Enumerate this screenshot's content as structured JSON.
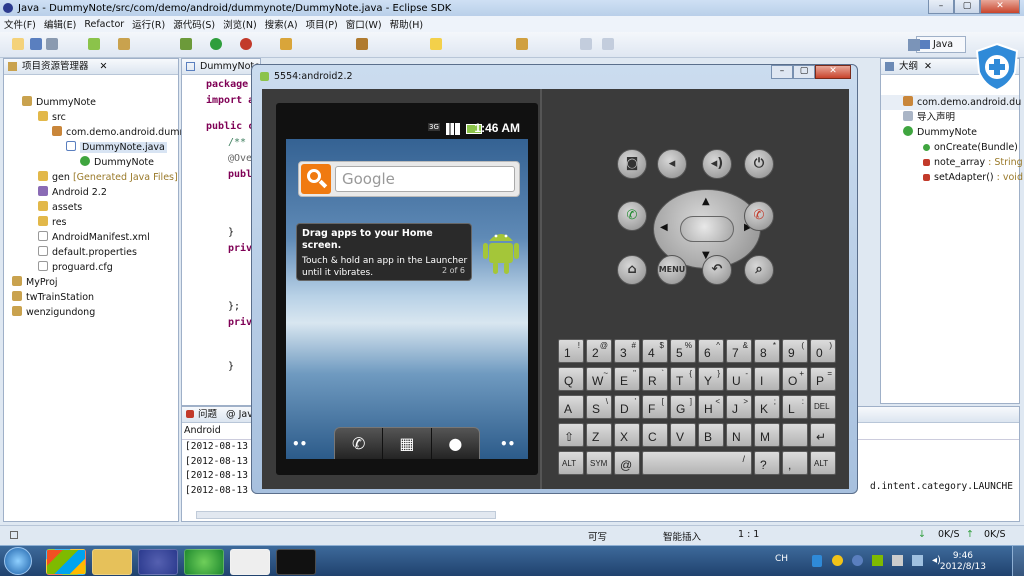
{
  "eclipse": {
    "title": "Java - DummyNote/src/com/demo/android/dummynote/DummyNote.java - Eclipse SDK",
    "menu": [
      "文件(F)",
      "编辑(E)",
      "Refactor",
      "运行(R)",
      "源代码(S)",
      "浏览(N)",
      "搜索(A)",
      "项目(P)",
      "窗口(W)",
      "帮助(H)"
    ],
    "perspective": "Java"
  },
  "explorer": {
    "tab": "项目资源管理器",
    "items": [
      {
        "label": "DummyNote"
      },
      {
        "label": "src"
      },
      {
        "label": "com.demo.android.dumm"
      },
      {
        "label": "DummyNote.java"
      },
      {
        "label": "DummyNote"
      },
      {
        "label": "gen",
        "extra": "[Generated Java Files]"
      },
      {
        "label": "Android 2.2"
      },
      {
        "label": "assets"
      },
      {
        "label": "res"
      },
      {
        "label": "AndroidManifest.xml"
      },
      {
        "label": "default.properties"
      },
      {
        "label": "proguard.cfg"
      },
      {
        "label": "MyProj"
      },
      {
        "label": "twTrainStation"
      },
      {
        "label": "wenzigundong"
      }
    ]
  },
  "editor": {
    "tab": "DummyNote",
    "lines": [
      "package",
      "import a",
      "public c",
      "/**",
      "@Ove",
      "publ",
      "}",
      "priv",
      "};",
      "priv",
      "}"
    ]
  },
  "outline": {
    "tab": "大纲",
    "items": [
      {
        "label": "com.demo.android.du"
      },
      {
        "label": "导入声明"
      },
      {
        "label": "DummyNote"
      },
      {
        "label": "onCreate(Bundle)"
      },
      {
        "label": "note_array",
        "type": ": String"
      },
      {
        "label": "setAdapter()",
        "type": ": void"
      }
    ]
  },
  "console": {
    "tabs": [
      "问题",
      "Jav"
    ],
    "heading": "Android",
    "lines": [
      "[2012-08-13",
      "[2012-08-13",
      "[2012-08-13",
      "[2012-08-13"
    ],
    "tail": "d.intent.category.LAUNCHE"
  },
  "emulator": {
    "title": "5554:android2.2",
    "status_signal": "3G",
    "clock": "1:46 AM",
    "search_placeholder": "Google",
    "tip_title": "Drag apps to your Home screen.",
    "tip_body": "Touch & hold an app in the Launcher until it vibrates.",
    "tip_page": "2 of 6",
    "menu_key": "MENU",
    "keyboard": {
      "row1": [
        [
          "1",
          "!"
        ],
        [
          "2",
          "@"
        ],
        [
          "3",
          "#"
        ],
        [
          "4",
          "$"
        ],
        [
          "5",
          "%"
        ],
        [
          "6",
          "^"
        ],
        [
          "7",
          "&"
        ],
        [
          "8",
          "*"
        ],
        [
          "9",
          "("
        ],
        [
          "0",
          ")"
        ]
      ],
      "row2": [
        [
          "Q",
          ""
        ],
        [
          "W",
          "~"
        ],
        [
          "E",
          "\""
        ],
        [
          "R",
          "`"
        ],
        [
          "T",
          "{"
        ],
        [
          "Y",
          "}"
        ],
        [
          "U",
          "-"
        ],
        [
          "I",
          ""
        ],
        [
          "O",
          "+"
        ],
        [
          "P",
          "="
        ]
      ],
      "row3": [
        [
          "A",
          ""
        ],
        [
          "S",
          "\\"
        ],
        [
          "D",
          "'"
        ],
        [
          "F",
          "["
        ],
        [
          "G",
          "]"
        ],
        [
          "H",
          "<"
        ],
        [
          "J",
          ">"
        ],
        [
          "K",
          ";"
        ],
        [
          "L",
          ":"
        ],
        [
          "DEL",
          ""
        ]
      ],
      "row4": [
        [
          "⇧",
          ""
        ],
        [
          "Z",
          ""
        ],
        [
          "X",
          ""
        ],
        [
          "C",
          ""
        ],
        [
          "V",
          ""
        ],
        [
          "B",
          ""
        ],
        [
          "N",
          ""
        ],
        [
          "M",
          ""
        ],
        [
          "",
          ""
        ],
        [
          "↵",
          ""
        ]
      ],
      "row5": [
        "ALT",
        "SYM",
        "@",
        "/",
        "?",
        ",",
        "ALT"
      ]
    }
  },
  "statusbar": {
    "mode": "可写",
    "insert": "智能插入",
    "position": "1 : 1"
  },
  "tray": {
    "time": "9:46",
    "date": "2012/8/13",
    "lang": "CH",
    "speed1": "0K/S",
    "speed2": "0K/S"
  },
  "colors": {
    "accent": "#2a5a9a",
    "keyword": "#7f0055",
    "android_green": "#8bc34a",
    "google_orange": "#f07a10"
  }
}
